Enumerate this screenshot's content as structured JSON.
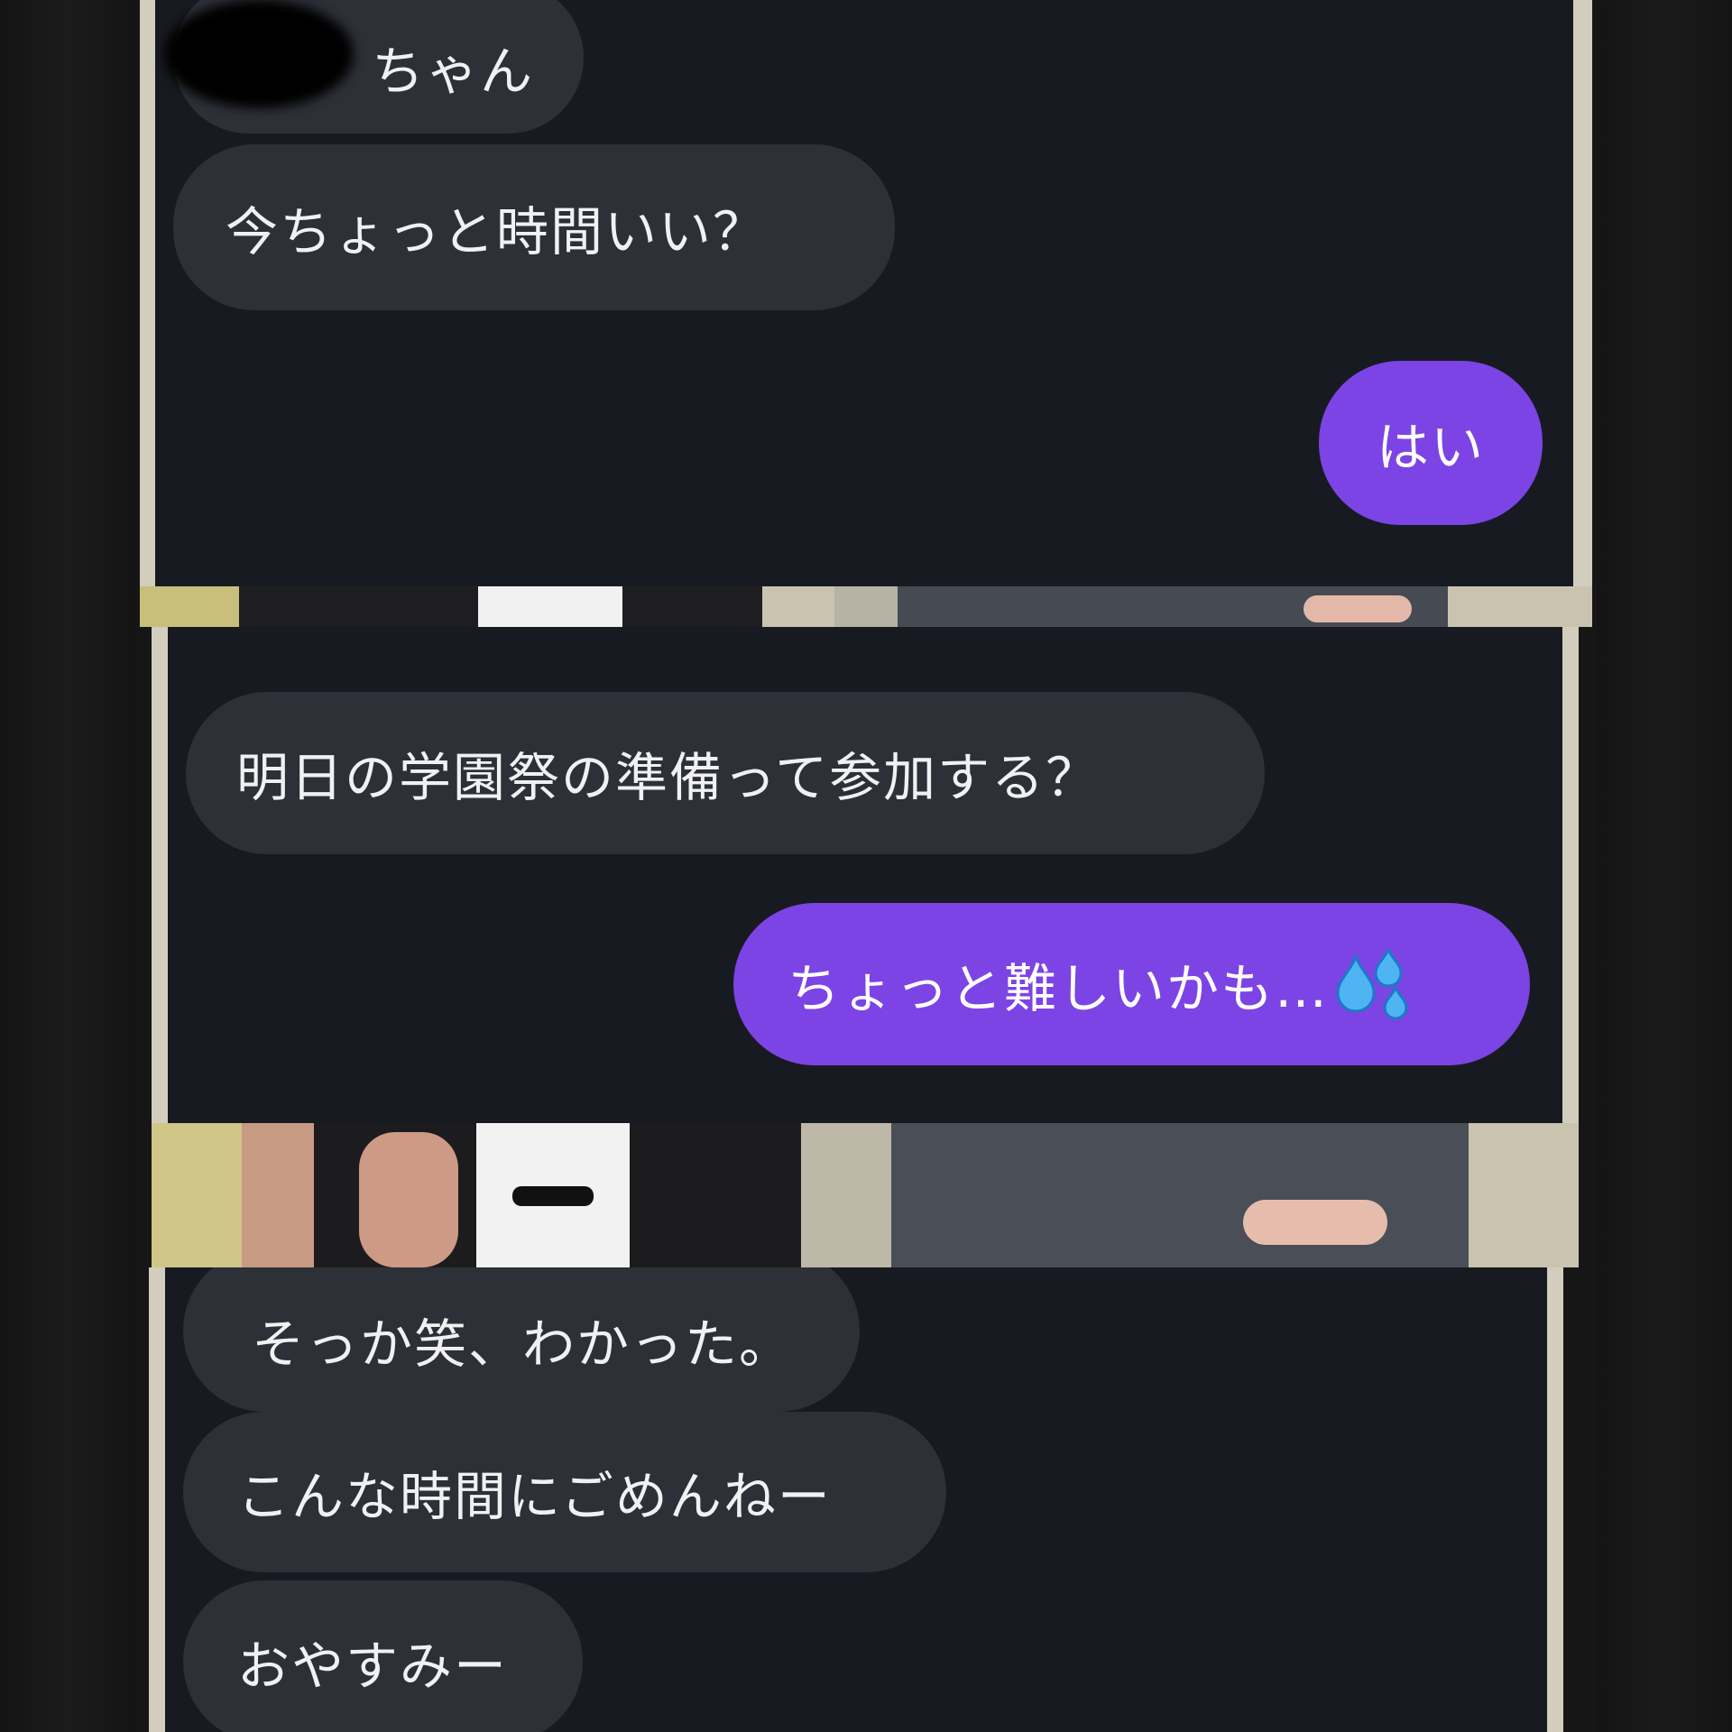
{
  "colors": {
    "chat_background": "#181a21",
    "received_bubble": "#2e3038",
    "sent_bubble": "#7c44e4",
    "frame": "#d2cdbd",
    "outer_background": "#161616"
  },
  "panels": [
    {
      "messages": [
        {
          "from": "other",
          "text": "ちゃん",
          "redacted_prefix": true
        },
        {
          "from": "other",
          "text": "今ちょっと時間いい？"
        },
        {
          "from": "me",
          "text": "はい"
        }
      ]
    },
    {
      "messages": [
        {
          "from": "other",
          "text": "明日の学園祭の準備って参加する？"
        },
        {
          "from": "me",
          "text": "ちょっと難しいかも…",
          "emoji": "sweat-droplets-icon"
        }
      ]
    },
    {
      "messages": [
        {
          "from": "other",
          "text": "そっか笑、わかった。"
        },
        {
          "from": "other",
          "text": "こんな時間にごめんねー"
        },
        {
          "from": "other",
          "text": "おやすみー"
        }
      ]
    }
  ]
}
